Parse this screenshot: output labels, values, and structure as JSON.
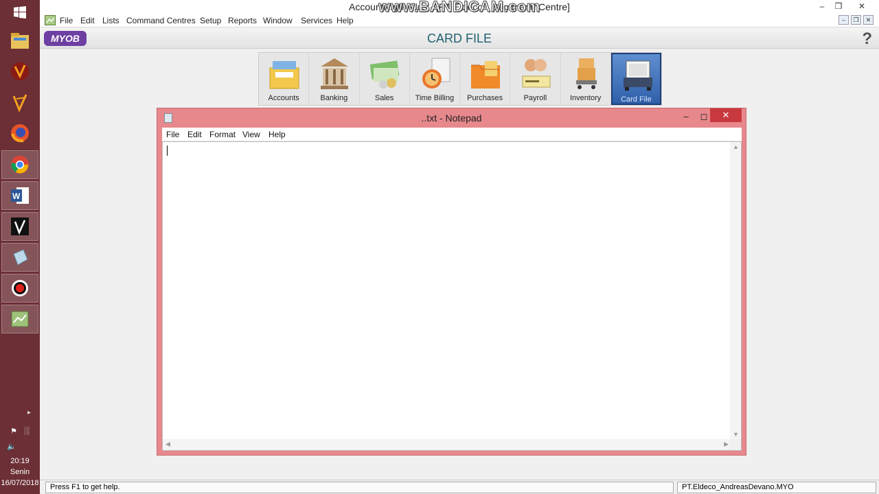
{
  "taskbar": {
    "apps": [
      {
        "name": "file-explorer-icon"
      },
      {
        "name": "mmorpg-app-icon"
      },
      {
        "name": "vector-app-icon"
      },
      {
        "name": "firefox-icon"
      },
      {
        "name": "chrome-icon"
      },
      {
        "name": "word-icon"
      },
      {
        "name": "vector-dark-app-icon"
      },
      {
        "name": "notepad-taskbar-icon"
      },
      {
        "name": "bandicam-record-icon"
      },
      {
        "name": "myob-taskbar-icon"
      }
    ],
    "time": "20:19",
    "day": "Senin",
    "date": "16/07/2018"
  },
  "window": {
    "title": "AccountRight Plus - [PT Eldeco - Command Centre]",
    "watermark": "www.BANDICAM.com"
  },
  "menu": [
    "File",
    "Edit",
    "Lists",
    "Command Centres",
    "Setup",
    "Reports",
    "Window",
    "Services",
    "Help"
  ],
  "command_centre": {
    "logo": "MYOB",
    "title": "CARD FILE",
    "modules": [
      {
        "label": "Accounts",
        "icon": "accounts-icon",
        "color": "#f2c94c"
      },
      {
        "label": "Banking",
        "icon": "banking-icon",
        "color": "#b58a5a"
      },
      {
        "label": "Sales",
        "icon": "sales-icon",
        "color": "#7fbf6a"
      },
      {
        "label": "Time Billing",
        "icon": "time-billing-icon",
        "color": "#e8742a"
      },
      {
        "label": "Purchases",
        "icon": "purchases-icon",
        "color": "#f08a2a"
      },
      {
        "label": "Payroll",
        "icon": "payroll-icon",
        "color": "#e2a878"
      },
      {
        "label": "Inventory",
        "icon": "inventory-icon",
        "color": "#e2a04a"
      },
      {
        "label": "Card File",
        "icon": "card-file-icon",
        "color": "#3b4a66",
        "selected": true
      }
    ]
  },
  "notepad": {
    "title": "..txt - Notepad",
    "menu": [
      "File",
      "Edit",
      "Format",
      "View",
      "Help"
    ],
    "content": ""
  },
  "status": {
    "left": "Press F1 to get help.",
    "right": "PT.Eldeco_AndreasDevano.MYO"
  }
}
